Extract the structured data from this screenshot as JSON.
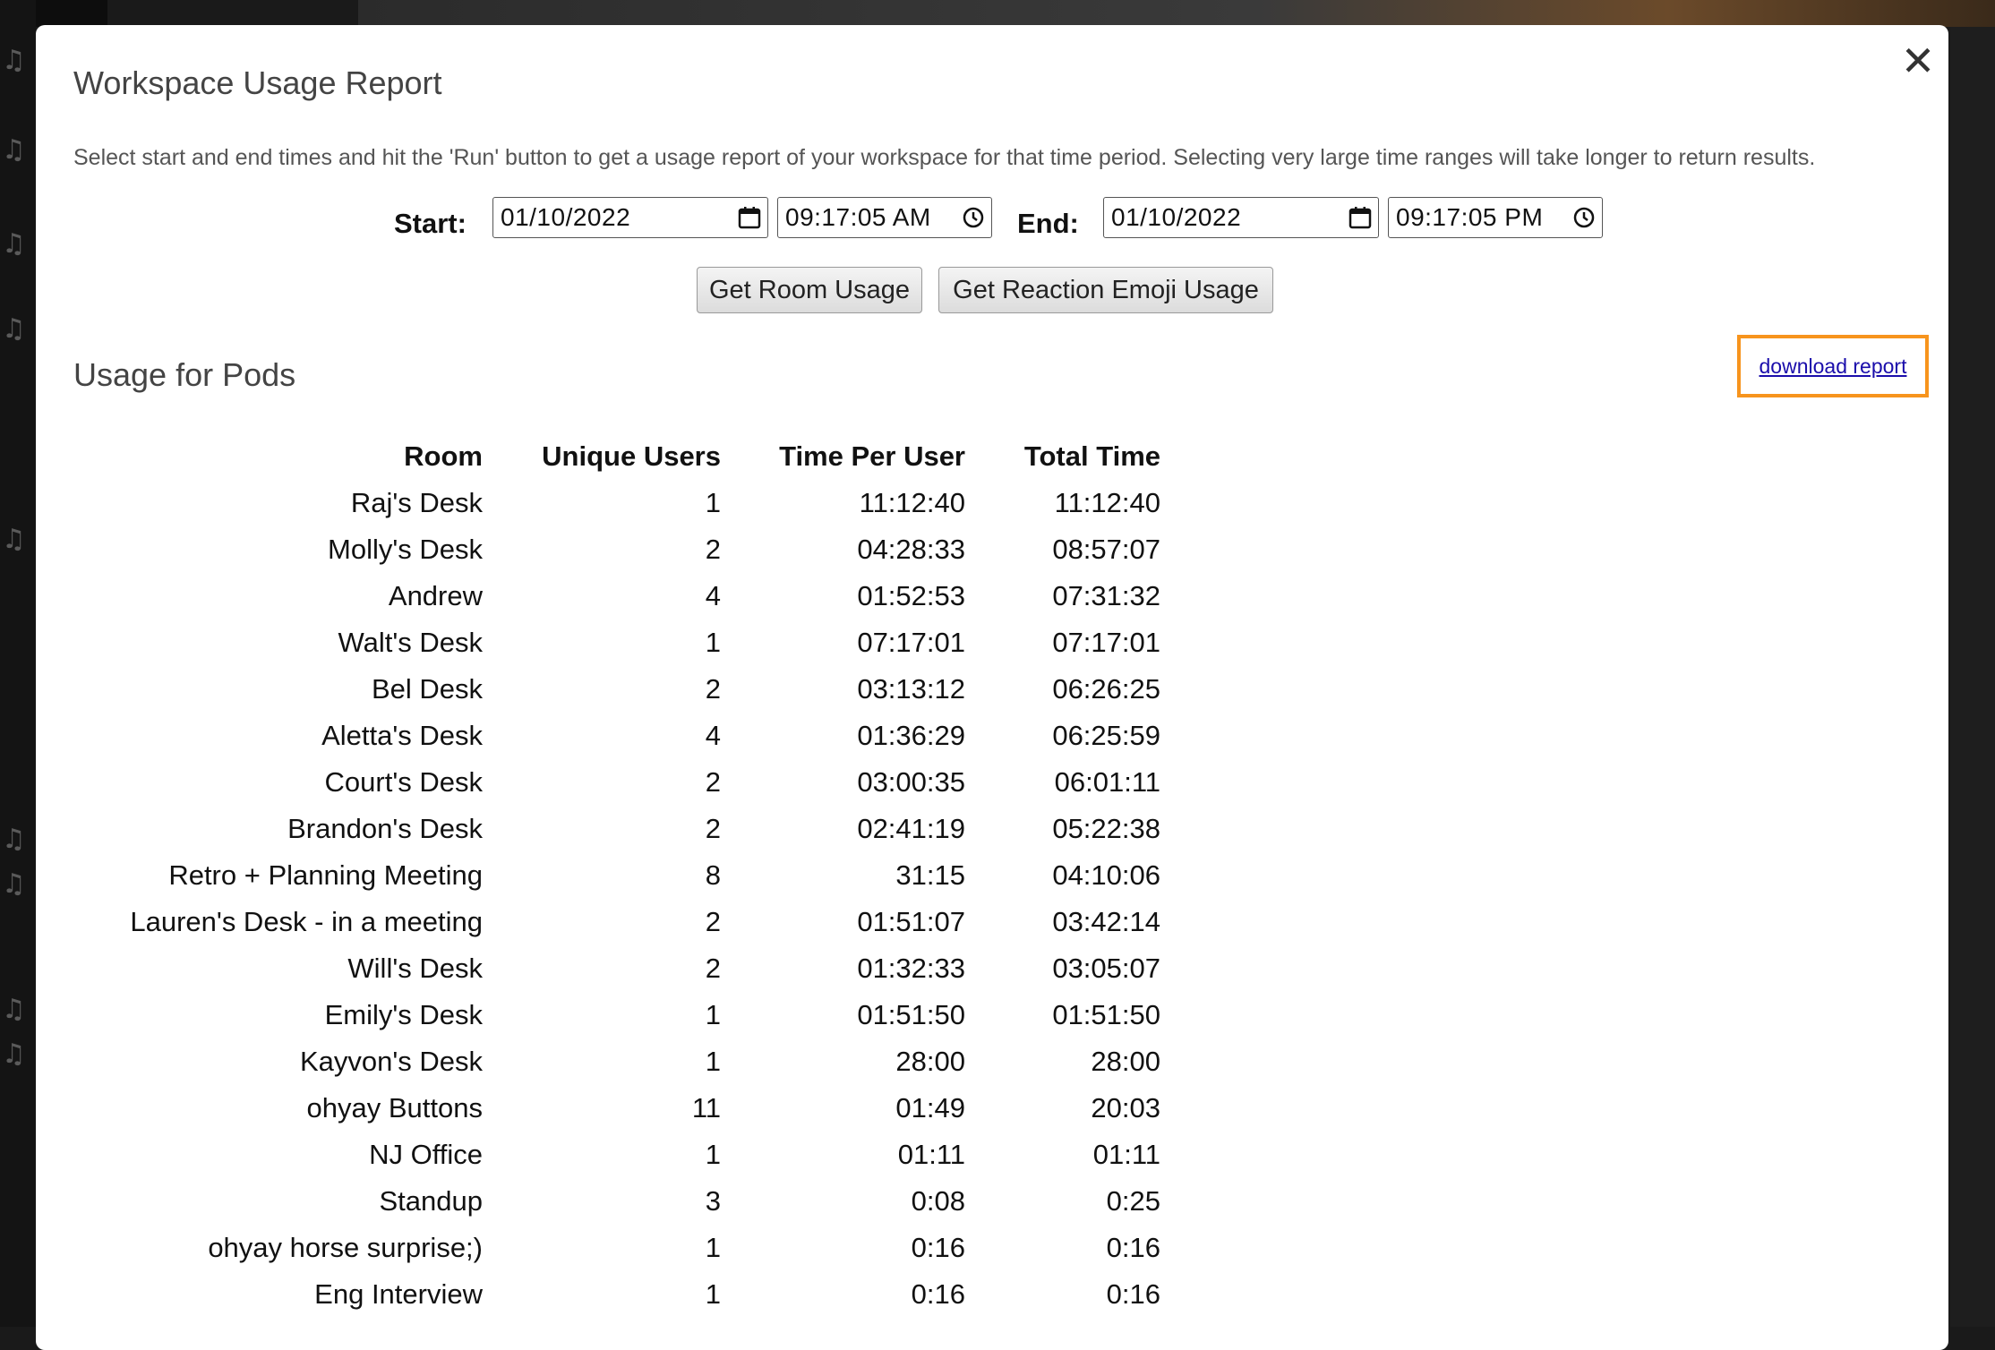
{
  "modal": {
    "title": "Workspace Usage Report",
    "description": "Select start and end times and hit the 'Run' button to get a usage report of your workspace for that time period. Selecting very large time ranges will take longer to return results.",
    "close_icon": "close-icon"
  },
  "form": {
    "start_label": "Start:",
    "start_date": "01/10/2022",
    "start_time": "09:17:05 AM",
    "end_label": "End:",
    "end_date": "01/10/2022",
    "end_time": "09:17:05 PM"
  },
  "buttons": {
    "room_usage": "Get Room Usage",
    "emoji_usage": "Get Reaction Emoji Usage"
  },
  "section": {
    "title": "Usage for Pods",
    "download_label": "download report",
    "highlight_color": "#f7941d"
  },
  "table": {
    "headers": [
      "Room",
      "Unique Users",
      "Time Per User",
      "Total Time"
    ],
    "rows": [
      [
        "Raj's Desk",
        "1",
        "11:12:40",
        "11:12:40"
      ],
      [
        "Molly's Desk",
        "2",
        "04:28:33",
        "08:57:07"
      ],
      [
        "Andrew",
        "4",
        "01:52:53",
        "07:31:32"
      ],
      [
        "Walt's Desk",
        "1",
        "07:17:01",
        "07:17:01"
      ],
      [
        "Bel Desk",
        "2",
        "03:13:12",
        "06:26:25"
      ],
      [
        "Aletta's Desk",
        "4",
        "01:36:29",
        "06:25:59"
      ],
      [
        "Court's Desk",
        "2",
        "03:00:35",
        "06:01:11"
      ],
      [
        "Brandon's Desk",
        "2",
        "02:41:19",
        "05:22:38"
      ],
      [
        "Retro + Planning Meeting",
        "8",
        "31:15",
        "04:10:06"
      ],
      [
        "Lauren's Desk - in a meeting",
        "2",
        "01:51:07",
        "03:42:14"
      ],
      [
        "Will's Desk",
        "2",
        "01:32:33",
        "03:05:07"
      ],
      [
        "Emily's Desk",
        "1",
        "01:51:50",
        "01:51:50"
      ],
      [
        "Kayvon's Desk",
        "1",
        "28:00",
        "28:00"
      ],
      [
        "ohyay Buttons",
        "11",
        "01:49",
        "20:03"
      ],
      [
        "NJ Office",
        "1",
        "01:11",
        "01:11"
      ],
      [
        "Standup",
        "3",
        "0:08",
        "0:25"
      ],
      [
        "ohyay horse surprise;)",
        "1",
        "0:16",
        "0:16"
      ],
      [
        "Eng Interview",
        "1",
        "0:16",
        "0:16"
      ]
    ]
  }
}
